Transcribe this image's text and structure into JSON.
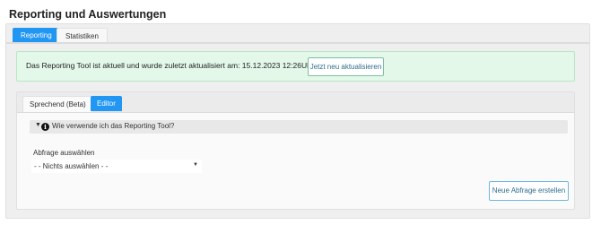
{
  "page": {
    "title": "Reporting und Auswertungen"
  },
  "tabs": [
    {
      "label": "Reporting",
      "active": true
    },
    {
      "label": "Statistiken",
      "active": false
    }
  ],
  "status_box": {
    "message": "Das Reporting Tool ist aktuell und wurde zuletzt aktualisiert am: 15.12.2023 12:26Uhr",
    "refresh_button": "Jetzt neu aktualisieren"
  },
  "inner_tabs": [
    {
      "label": "Sprechend (Beta)",
      "active": false
    },
    {
      "label": "Editor",
      "active": true
    }
  ],
  "howto": {
    "label": "Wie verwende ich das Reporting Tool?",
    "icon": "info-icon"
  },
  "query_select": {
    "label": "Abfrage auswählen",
    "selected": "- - Nichts auswählen - -"
  },
  "new_query_button": "Neue Abfrage erstellen",
  "colors": {
    "accent": "#2196f3",
    "success_bg": "#e3f8e9"
  }
}
